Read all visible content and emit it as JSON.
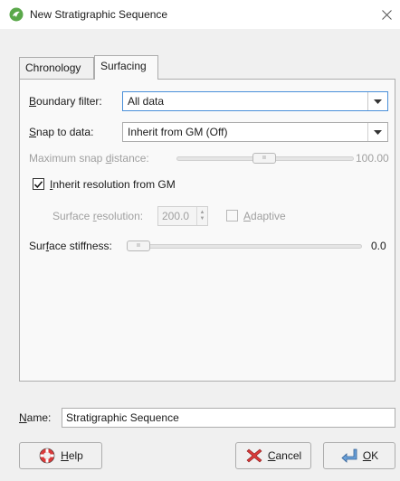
{
  "window": {
    "title": "New Stratigraphic Sequence"
  },
  "tabs": [
    {
      "label": "Chronology",
      "active": false
    },
    {
      "label": "Surfacing",
      "active": true
    }
  ],
  "surfacing": {
    "boundary_filter": {
      "label_u": "B",
      "label_rest": "oundary filter:",
      "value": "All data"
    },
    "snap_to_data": {
      "label_u": "S",
      "label_rest": "nap to data:",
      "value": "Inherit from GM (Off)"
    },
    "max_snap": {
      "label_pre": "Maximum snap ",
      "label_u": "d",
      "label_rest": "istance:",
      "value": "100.00",
      "level_fraction": 0.5
    },
    "inherit_resolution": {
      "label_u": "I",
      "label_rest": "nherit resolution from GM",
      "checked": true
    },
    "surface_resolution": {
      "label_pre": "Surface ",
      "label_u": "r",
      "label_rest": "esolution:",
      "value": "200.0"
    },
    "adaptive": {
      "label_u": "A",
      "label_rest": "daptive",
      "checked": false
    },
    "surface_stiffness": {
      "label_pre": "Sur",
      "label_u": "f",
      "label_rest": "ace stiffness:",
      "value": "0.0",
      "level_fraction": 0.0
    }
  },
  "name_field": {
    "label_u": "N",
    "label_rest": "ame:",
    "value": "Stratigraphic Sequence"
  },
  "buttons": {
    "help": {
      "label_u": "H",
      "label_rest": "elp"
    },
    "cancel": {
      "label_u": "C",
      "label_rest": "ancel"
    },
    "ok": {
      "label_u": "O",
      "label_rest": "K"
    }
  },
  "colors": {
    "accent": "#4a90d9",
    "app_icon": "#5aa84a"
  }
}
